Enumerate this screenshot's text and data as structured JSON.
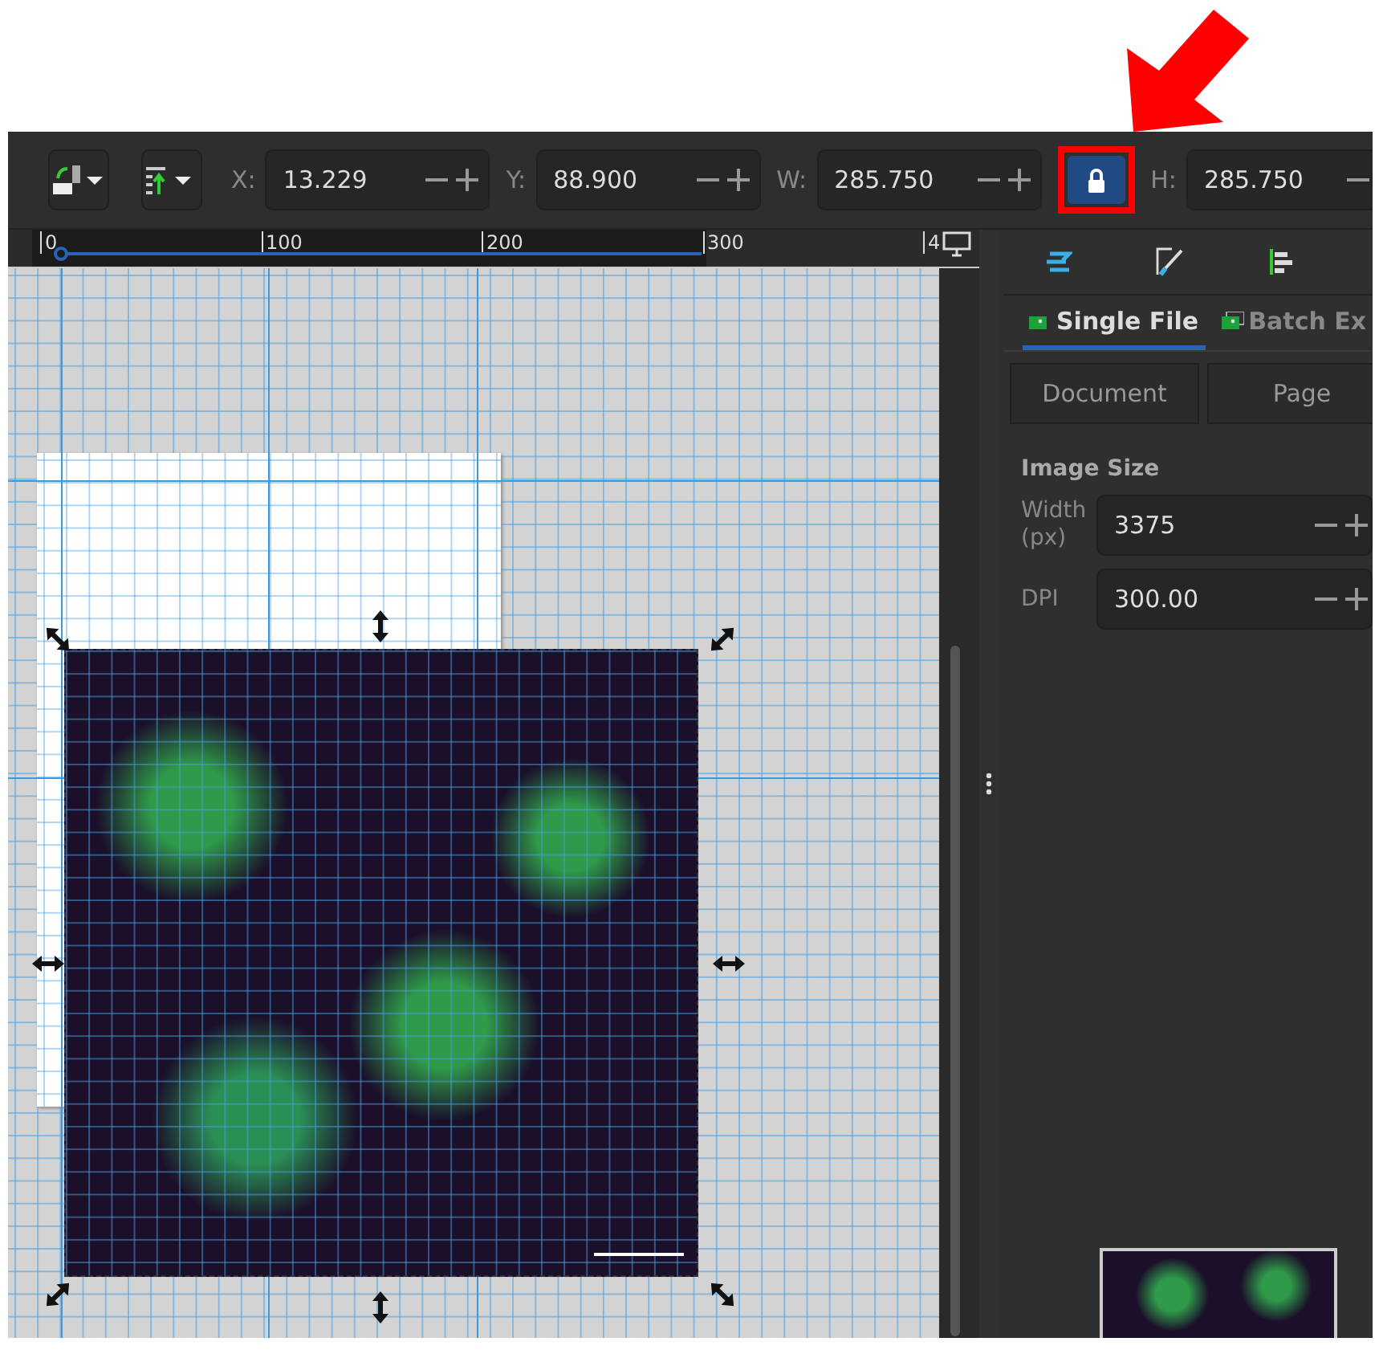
{
  "toolbar": {
    "items": [
      {
        "kind": "field",
        "label": "X:",
        "value": "13.229"
      },
      {
        "kind": "field",
        "label": "Y:",
        "value": "88.900"
      },
      {
        "kind": "field",
        "label": "W:",
        "value": "285.750"
      },
      {
        "kind": "lock",
        "on": true
      },
      {
        "kind": "field",
        "label": "H:",
        "value": "285.750"
      }
    ]
  },
  "ruler": {
    "labels": [
      "0",
      "100",
      "200",
      "300",
      "4"
    ]
  },
  "dock": {
    "export_tabs": [
      {
        "label": "Single File",
        "selected": true
      },
      {
        "label": "Batch Ex",
        "selected": false
      }
    ],
    "area_buttons": [
      "Document",
      "Page"
    ],
    "section_title": "Image Size",
    "fields": [
      {
        "label": "Width (px)",
        "value": "3375"
      },
      {
        "label": "DPI",
        "value": "300.00"
      }
    ]
  }
}
